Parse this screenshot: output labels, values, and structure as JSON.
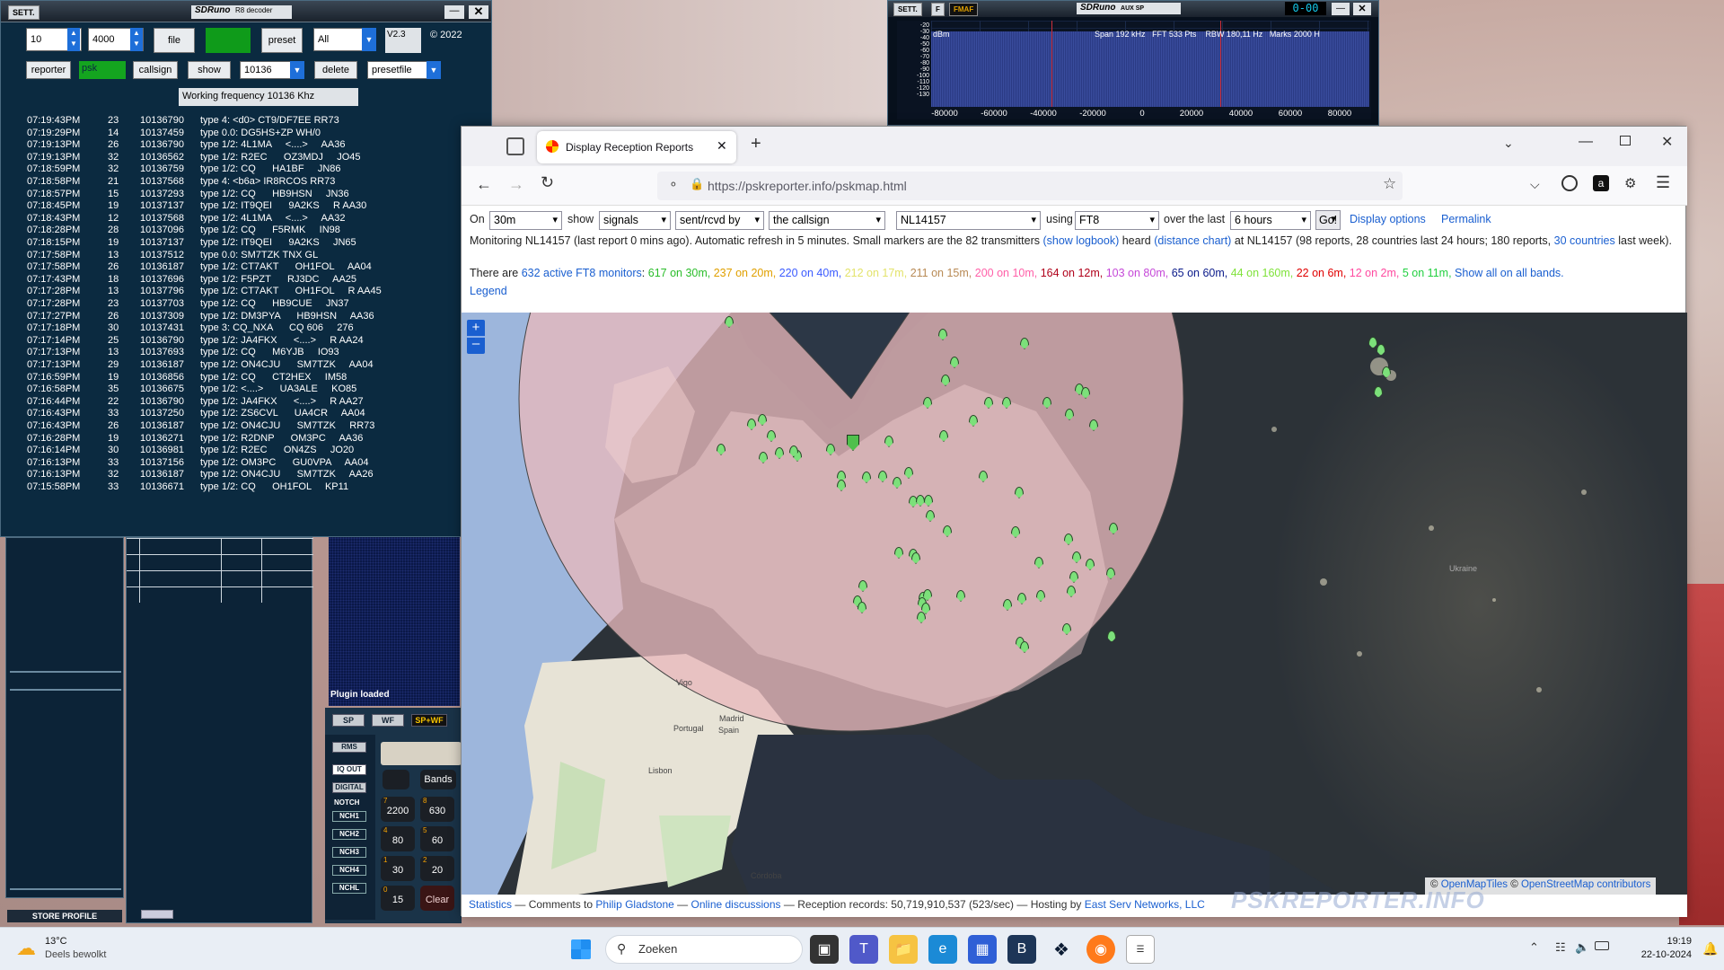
{
  "decoder": {
    "title_settings": "SETT.",
    "title": "SDRuno",
    "subtitle": "R8 decoder",
    "spin1": "10",
    "spin2": "4000",
    "file_label": "file",
    "preset_label": "preset",
    "all_select": "All",
    "version": "V2.3",
    "copyright": "© 2022",
    "reporter_label": "reporter",
    "psk_label": "psk",
    "callsign_label": "callsign",
    "show_label": "show",
    "freq_select": "10136",
    "delete_label": "delete",
    "presetfile_select": "presetfile",
    "working_freq": "Working frequency 10136 Khz",
    "log": [
      [
        "07:19:43PM",
        "23",
        "10136790",
        "type 4: <d0> CT9/DF7EE RR73"
      ],
      [
        "07:19:29PM",
        "14",
        "10137459",
        "type 0.0: DG5HS+ZP WH/0"
      ],
      [
        "07:19:13PM",
        "26",
        "10136790",
        "type 1/2: 4L1MA     <....>     AA36"
      ],
      [
        "07:19:13PM",
        "32",
        "10136562",
        "type 1/2: R2EC      OZ3MDJ     JO45"
      ],
      [
        "07:18:59PM",
        "32",
        "10136759",
        "type 1/2: CQ      HA1BF     JN86"
      ],
      [
        "07:18:58PM",
        "21",
        "10137568",
        "type 4: <b6a> IR8RCOS RR73"
      ],
      [
        "07:18:57PM",
        "15",
        "10137293",
        "type 1/2: CQ      HB9HSN     JN36"
      ],
      [
        "07:18:45PM",
        "19",
        "10137137",
        "type 1/2: IT9QEI      9A2KS     R AA30"
      ],
      [
        "07:18:43PM",
        "12",
        "10137568",
        "type 1/2: 4L1MA     <....>     AA32"
      ],
      [
        "07:18:28PM",
        "28",
        "10137096",
        "type 1/2: CQ      F5RMK     IN98"
      ],
      [
        "07:18:15PM",
        "19",
        "10137137",
        "type 1/2: IT9QEI      9A2KS     JN65"
      ],
      [
        "07:17:58PM",
        "13",
        "10137512",
        "type 0.0: SM7TZK TNX GL"
      ],
      [
        "07:17:58PM",
        "26",
        "10136187",
        "type 1/2: CT7AKT      OH1FOL     AA04"
      ],
      [
        "07:17:43PM",
        "18",
        "10137696",
        "type 1/2: F5PZT      RJ3DC     AA25"
      ],
      [
        "07:17:28PM",
        "13",
        "10137796",
        "type 1/2: CT7AKT      OH1FOL     R AA45"
      ],
      [
        "07:17:28PM",
        "23",
        "10137703",
        "type 1/2: CQ      HB9CUE     JN37"
      ],
      [
        "07:17:27PM",
        "26",
        "10137309",
        "type 1/2: DM3PYA      HB9HSN     AA36"
      ],
      [
        "07:17:18PM",
        "30",
        "10137431",
        "type 3: CQ_NXA      CQ 606     276"
      ],
      [
        "07:17:14PM",
        "25",
        "10136790",
        "type 1/2: JA4FKX      <....>     R AA24"
      ],
      [
        "07:17:13PM",
        "13",
        "10137693",
        "type 1/2: CQ      M6YJB     IO93"
      ],
      [
        "07:17:13PM",
        "29",
        "10136187",
        "type 1/2: ON4CJU      SM7TZK     AA04"
      ],
      [
        "07:16:59PM",
        "19",
        "10136856",
        "type 1/2: CQ      CT2HEX     IM58"
      ],
      [
        "07:16:58PM",
        "35",
        "10136675",
        "type 1/2: <....>      UA3ALE     KO85"
      ],
      [
        "07:16:44PM",
        "22",
        "10136790",
        "type 1/2: JA4FKX      <....>     R AA27"
      ],
      [
        "07:16:43PM",
        "33",
        "10137250",
        "type 1/2: ZS6CVL      UA4CR     AA04"
      ],
      [
        "07:16:43PM",
        "26",
        "10136187",
        "type 1/2: ON4CJU      SM7TZK     RR73"
      ],
      [
        "07:16:28PM",
        "19",
        "10136271",
        "type 1/2: R2DNP      OM3PC     AA36"
      ],
      [
        "07:16:14PM",
        "30",
        "10136981",
        "type 1/2: R2EC      ON4ZS     JO20"
      ],
      [
        "07:16:13PM",
        "33",
        "10137156",
        "type 1/2: OM3PC      GU0VPA     AA04"
      ],
      [
        "07:16:13PM",
        "32",
        "10136187",
        "type 1/2: ON4CJU      SM7TZK     AA26"
      ],
      [
        "07:15:58PM",
        "33",
        "10136671",
        "type 1/2: CQ      OH1FOL     KP11"
      ]
    ]
  },
  "sdr_panels": {
    "plugin_loaded": "Plugin loaded",
    "sp": "SP",
    "wf": "WF",
    "spwf": "SP+WF",
    "rms": "RMS",
    "iq_out": "IQ OUT",
    "digital": "DIGITAL",
    "notch": "NOTCH",
    "nch": [
      "NCH1",
      "NCH2",
      "NCH3",
      "NCH4",
      "NCHL"
    ],
    "store_profile": "STORE PROFILE",
    "bands": "Bands",
    "keys": [
      "2200",
      "630",
      "80",
      "60",
      "30",
      "20",
      "15",
      "Clear"
    ],
    "key_digits": [
      "7",
      "8",
      "4",
      "5",
      "1",
      "2",
      "0"
    ]
  },
  "aux": {
    "settings": "SETT.",
    "f": "F",
    "fmaf": "FMAF",
    "title": "SDRuno",
    "subtitle": "AUX SP",
    "counter": "0-00",
    "dbm": "dBm",
    "span": "Span 192 kHz",
    "fft": "FFT 533 Pts",
    "rbw": "RBW 180,11 Hz",
    "marks": "Marks 2000 H",
    "db_ticks": [
      "-20",
      "-30",
      "-40",
      "-50",
      "-60",
      "-70",
      "-80",
      "-90",
      "-100",
      "-110",
      "-120",
      "-130"
    ],
    "x_ticks": [
      "-80000",
      "-60000",
      "-40000",
      "-20000",
      "0",
      "20000",
      "40000",
      "60000",
      "80000"
    ]
  },
  "browser": {
    "tab_title": "Display Reception Reports",
    "url": "https://pskreporter.info/pskmap.html",
    "controls": {
      "on": "On",
      "band": "30m",
      "show": "show",
      "signals": "signals",
      "sent": "sent/rcvd by",
      "callsign_mode": "the callsign",
      "callsign_value": "NL14157",
      "using": "using",
      "mode": "FT8",
      "over": "over the last",
      "period": "6 hours",
      "go": "Go!",
      "display_options": "Display options",
      "permalink": "Permalink"
    },
    "status1_a": "Monitoring NL14157 (last report 0 mins ago). Automatic refresh in 5 minutes. Small markers are the 82 transmitters",
    "status1_logbook": "(show logbook)",
    "status1_heard": "heard",
    "status1_distance": "(distance chart)",
    "status1_b": "at NL14157 (98 reports, 28 countries last 24 hours; 180 reports,",
    "status1_countries": "30 countries",
    "status1_c": "last week).",
    "monitors_prefix": "There are",
    "monitors_link": "632 active FT8 monitors",
    "bands": [
      {
        "text": "617 on 30m",
        "color": "#2bbd2b"
      },
      {
        "text": "237 on 20m",
        "color": "#e0a000"
      },
      {
        "text": "220 on 40m",
        "color": "#3b5bff"
      },
      {
        "text": "212 on 17m",
        "color": "#e3e36b"
      },
      {
        "text": "211 on 15m",
        "color": "#b88a55"
      },
      {
        "text": "200 on 10m",
        "color": "#ff5fa8"
      },
      {
        "text": "164 on 12m",
        "color": "#b0001a"
      },
      {
        "text": "103 on 80m",
        "color": "#c548d8"
      },
      {
        "text": "65 on 60m",
        "color": "#0a1a8a"
      },
      {
        "text": "44 on 160m",
        "color": "#7fe23a"
      },
      {
        "text": "22 on 6m",
        "color": "#e00000"
      },
      {
        "text": "12 on 2m",
        "color": "#ff4aa0"
      },
      {
        "text": "5 on 11m",
        "color": "#22d040"
      }
    ],
    "show_all": "Show all on all bands.",
    "legend": "Legend",
    "map_labels": {
      "vigo": "Vigo",
      "portugal": "Portugal",
      "lisbon": "Lisbon",
      "madrid": "Madrid",
      "spain": "Spain",
      "cordoba": "Córdoba",
      "ukraine": "Ukraine"
    },
    "attribution_c": "©",
    "attribution_tiles": "OpenMapTiles",
    "attribution_osm": "OpenStreetMap contributors",
    "watermark": "PSKREPORTER.INFO",
    "footer": {
      "statistics": "Statistics",
      "comments": "— Comments to",
      "gladstone": "Philip Gladstone",
      "sep": "—",
      "online": "Online discussions",
      "records": "— Reception records: 50,719,910,537 (523/sec) — Hosting by",
      "host": "East Serv Networks, LLC"
    }
  },
  "taskbar": {
    "temp": "13°C",
    "weather": "Deels bewolkt",
    "search": "Zoeken",
    "time": "19:19",
    "date": "22-10-2024"
  }
}
